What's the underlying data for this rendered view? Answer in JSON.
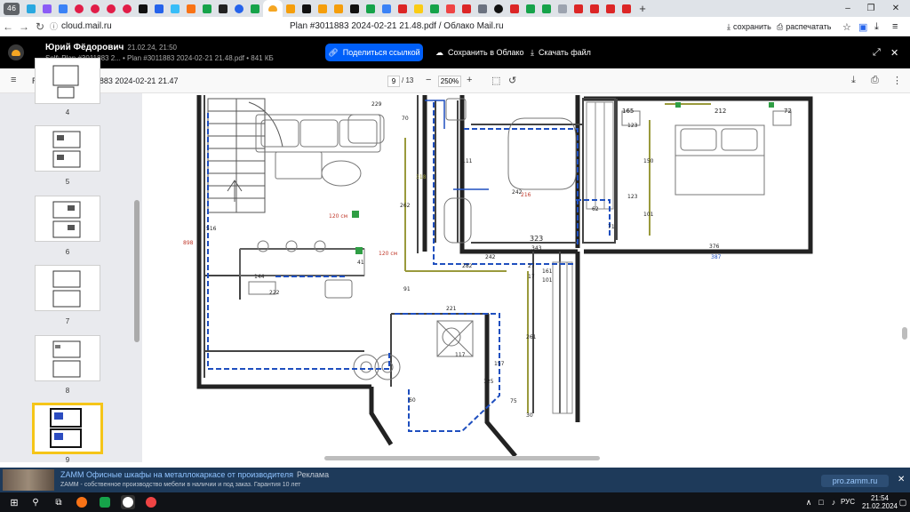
{
  "browser": {
    "tab_count": "46",
    "url": "cloud.mail.ru",
    "page_title": "Plan #3011883 2024-02-21 21.48.pdf / Облако Mail.ru",
    "save_label": "сохранить",
    "print_label": "распечатать"
  },
  "viewer": {
    "owner_name": "Юрий Фёдорович",
    "owner_date": "21.02.24, 21:50",
    "file_path": "Self: Plan #3011883 2... • Plan #3011883 2024-02-21 21.48.pdf • 841 КБ",
    "share_label": "Поделиться ссылкой",
    "save_cloud_label": "Сохранить в Облако",
    "download_label": "Скачать файл"
  },
  "pdf": {
    "doc_title": "Remplanner #3011883 2024-02-21 21.47",
    "current_page": "9",
    "total_pages": "/ 13",
    "zoom": "250%"
  },
  "thumbnails": [
    {
      "label": "4"
    },
    {
      "label": "5"
    },
    {
      "label": "6"
    },
    {
      "label": "7"
    },
    {
      "label": "8"
    },
    {
      "label": "9"
    }
  ],
  "plan": {
    "dims": {
      "d229": "229",
      "d70": "70",
      "d318": "318",
      "d262": "262",
      "d898": "898",
      "d516": "516",
      "d120a": "120 см",
      "d120b": "120 см",
      "d41": "41",
      "d144": "144",
      "d222": "222",
      "d91": "91",
      "d111": "111",
      "d242a": "242",
      "d216": "216",
      "d62": "62",
      "d323": "323",
      "d71": "71",
      "d242b": "242",
      "d343": "343",
      "d282": "282",
      "d27": "27",
      "d17": "17",
      "d101a": "101",
      "d161": "161",
      "d165": "165",
      "d212": "212",
      "d72": "72",
      "d123a": "123",
      "d150": "150",
      "d123b": "123",
      "d101b": "101",
      "d376": "376",
      "d387": "387",
      "d221": "221",
      "d117": "117",
      "d157": "157",
      "d261": "261",
      "d75": "75",
      "d30": "30",
      "d125": "125",
      "d60": "60"
    }
  },
  "ad": {
    "title": "ZAMM Офисные шкафы на металлокаркасе от производителя",
    "label": "Реклама",
    "text": "ZAMM - собственное производство мебели в наличии и под заказ. Гарантия 10 лет",
    "domain": "pro.zamm.ru"
  },
  "taskbar": {
    "time": "21:54",
    "date": "21.02.2024",
    "lang": "РУС"
  },
  "colors": {
    "accent": "#005ff9",
    "header_bg": "#000000",
    "ad_bg": "#1e3a5a",
    "plan_blue": "#1f4fbf",
    "plan_olive": "#9a9a3c"
  }
}
